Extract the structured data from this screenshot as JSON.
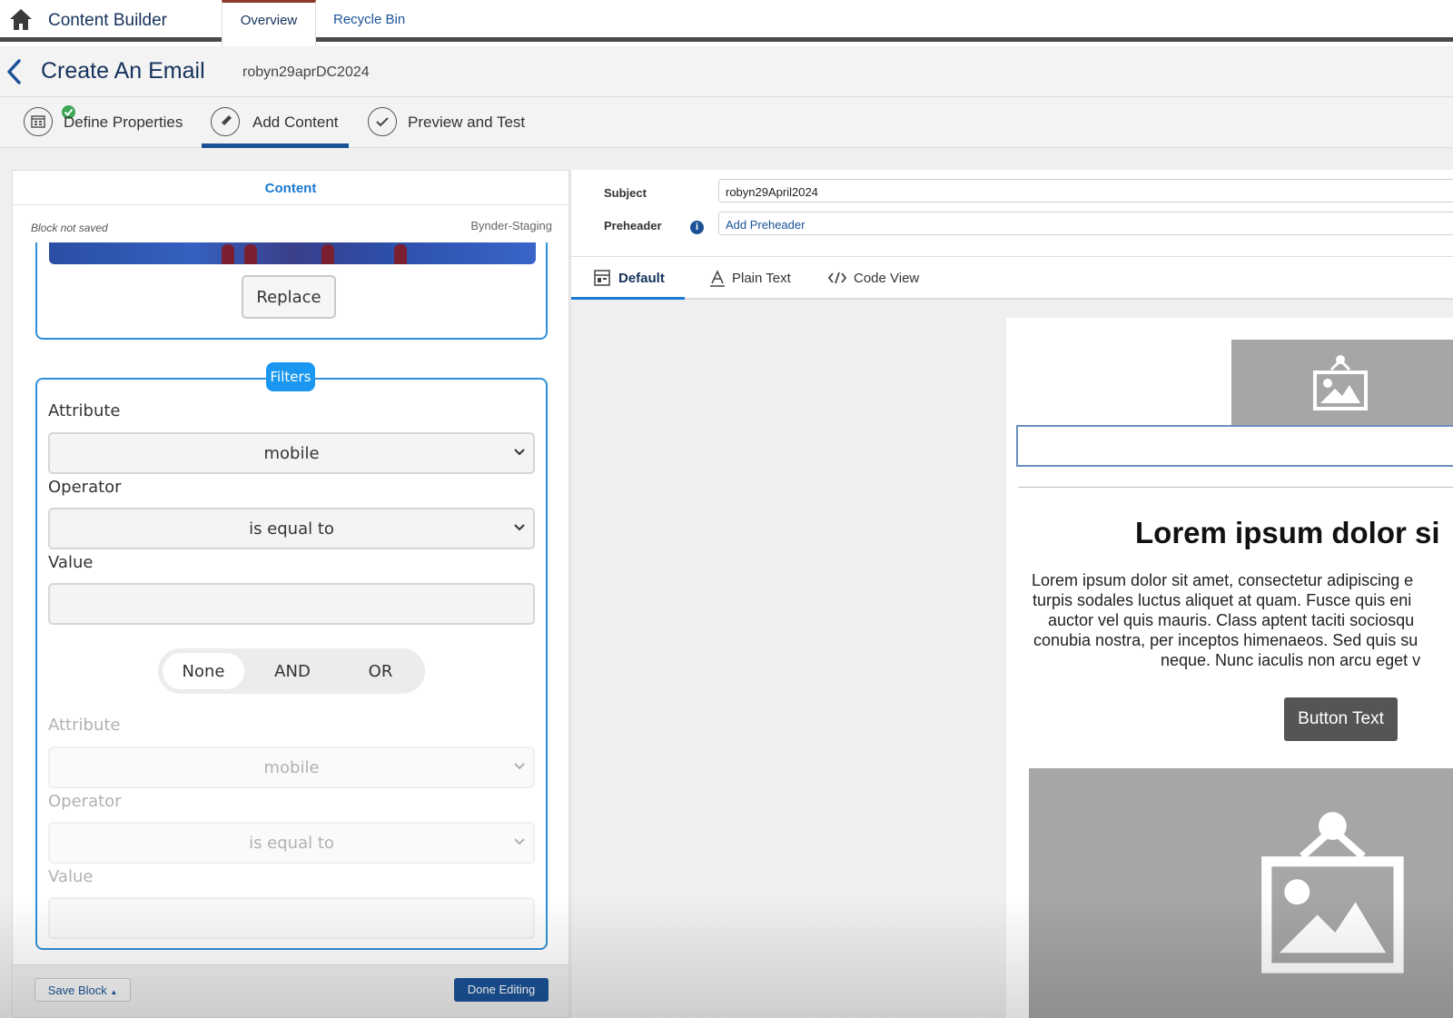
{
  "app": {
    "title": "Content Builder",
    "tabs": [
      {
        "label": "Overview",
        "active": true
      },
      {
        "label": "Recycle Bin",
        "active": false
      }
    ]
  },
  "header": {
    "title": "Create An Email",
    "subtitle": "robyn29aprDC2024"
  },
  "steps": [
    {
      "label": "Define Properties",
      "icon": "calendar-check-icon",
      "complete": true
    },
    {
      "label": "Add Content",
      "icon": "pencil-icon",
      "active": true
    },
    {
      "label": "Preview and Test",
      "icon": "checkmark-icon"
    }
  ],
  "content_panel": {
    "header": "Content",
    "status": "Block not saved",
    "source": "Bynder-Staging",
    "replace_label": "Replace",
    "filters_label": "Filters",
    "filter1": {
      "attribute_label": "Attribute",
      "attribute_value": "mobile",
      "operator_label": "Operator",
      "operator_value": "is equal to",
      "value_label": "Value",
      "value": ""
    },
    "logic": {
      "options": [
        "None",
        "AND",
        "OR"
      ],
      "selected": "None"
    },
    "filter2": {
      "attribute_label": "Attribute",
      "attribute_value": "mobile",
      "operator_label": "Operator",
      "operator_value": "is equal to",
      "value_label": "Value",
      "value": ""
    },
    "save_label": "Save Block",
    "done_label": "Done Editing"
  },
  "email_panel": {
    "subject_label": "Subject",
    "subject_value": "robyn29April2024",
    "preheader_label": "Preheader",
    "preheader_placeholder": "Add Preheader",
    "tabs": [
      {
        "label": "Default",
        "icon": "layout-icon",
        "active": true
      },
      {
        "label": "Plain Text",
        "icon": "text-icon"
      },
      {
        "label": "Code View",
        "icon": "code-icon"
      }
    ],
    "preview": {
      "headline": "Lorem ipsum dolor si",
      "body_lines": [
        "Lorem ipsum dolor sit amet, consectetur adipiscing e",
        "turpis sodales luctus aliquet at quam. Fusce quis eni",
        "auctor vel quis mauris. Class aptent taciti sociosqu",
        "conubia nostra, per inceptos himenaeos. Sed quis su",
        "neque. Nunc iaculis non arcu eget v"
      ],
      "button_text": "Button Text"
    }
  },
  "colors": {
    "brand_blue": "#1b5297",
    "accent_blue": "#1a97f0",
    "success_green": "#3ba755"
  }
}
